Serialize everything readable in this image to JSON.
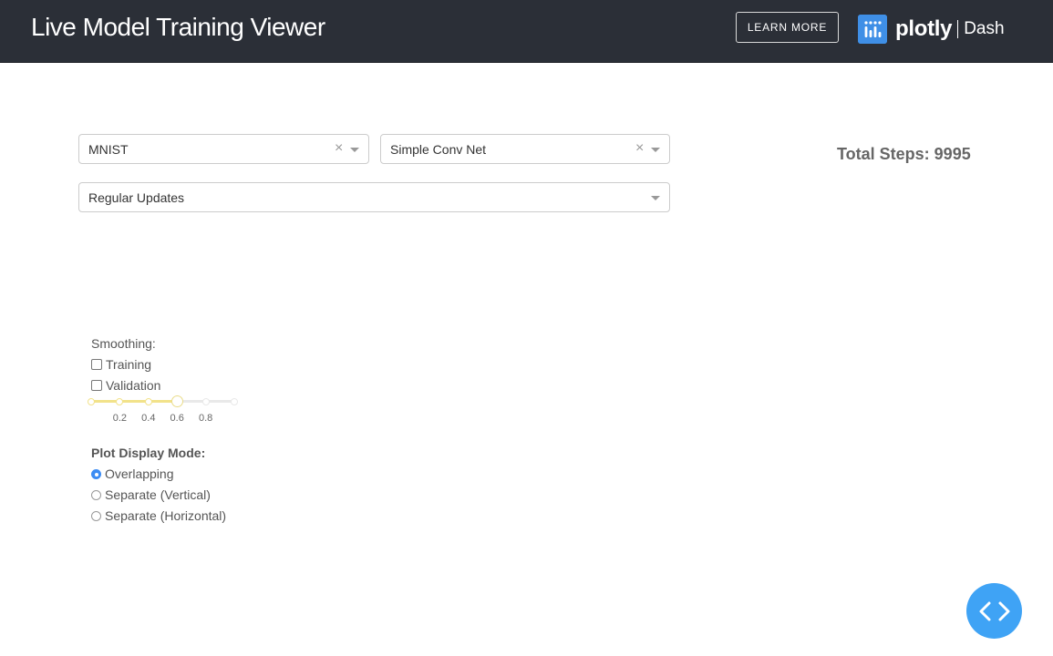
{
  "banner": {
    "title": "Live Model Training Viewer",
    "learn_more_label": "LEARN MORE",
    "brand": {
      "word": "plotly",
      "product": "Dash"
    }
  },
  "controls": {
    "dataset": {
      "value": "MNIST"
    },
    "model": {
      "value": "Simple Conv Net"
    },
    "update_mode": {
      "value": "Regular Updates"
    }
  },
  "total_steps": "Total Steps: 9995",
  "smoothing": {
    "label": "Smoothing:",
    "checkboxes": [
      {
        "label": "Training",
        "checked": false
      },
      {
        "label": "Validation",
        "checked": false
      }
    ],
    "slider": {
      "value": 0.6,
      "min": 0,
      "max": 1,
      "marks": [
        "0.2",
        "0.4",
        "0.6",
        "0.8"
      ]
    }
  },
  "display_mode": {
    "label": "Plot Display Mode:",
    "options": [
      {
        "label": "Overlapping",
        "selected": true
      },
      {
        "label": "Separate (Vertical)",
        "selected": false
      },
      {
        "label": "Separate (Horizontal)",
        "selected": false
      }
    ]
  },
  "colors": {
    "banner_bg": "#2b2f37",
    "accent_blue": "#3c8cf3",
    "slider_yellow": "#f2e28a",
    "fab_blue": "#3fa3f5"
  },
  "icons": {
    "brand": "plotly-logo-icon",
    "clear": "clear-icon",
    "dropdown": "chevron-down-icon",
    "fab": "code-brackets-icon"
  }
}
